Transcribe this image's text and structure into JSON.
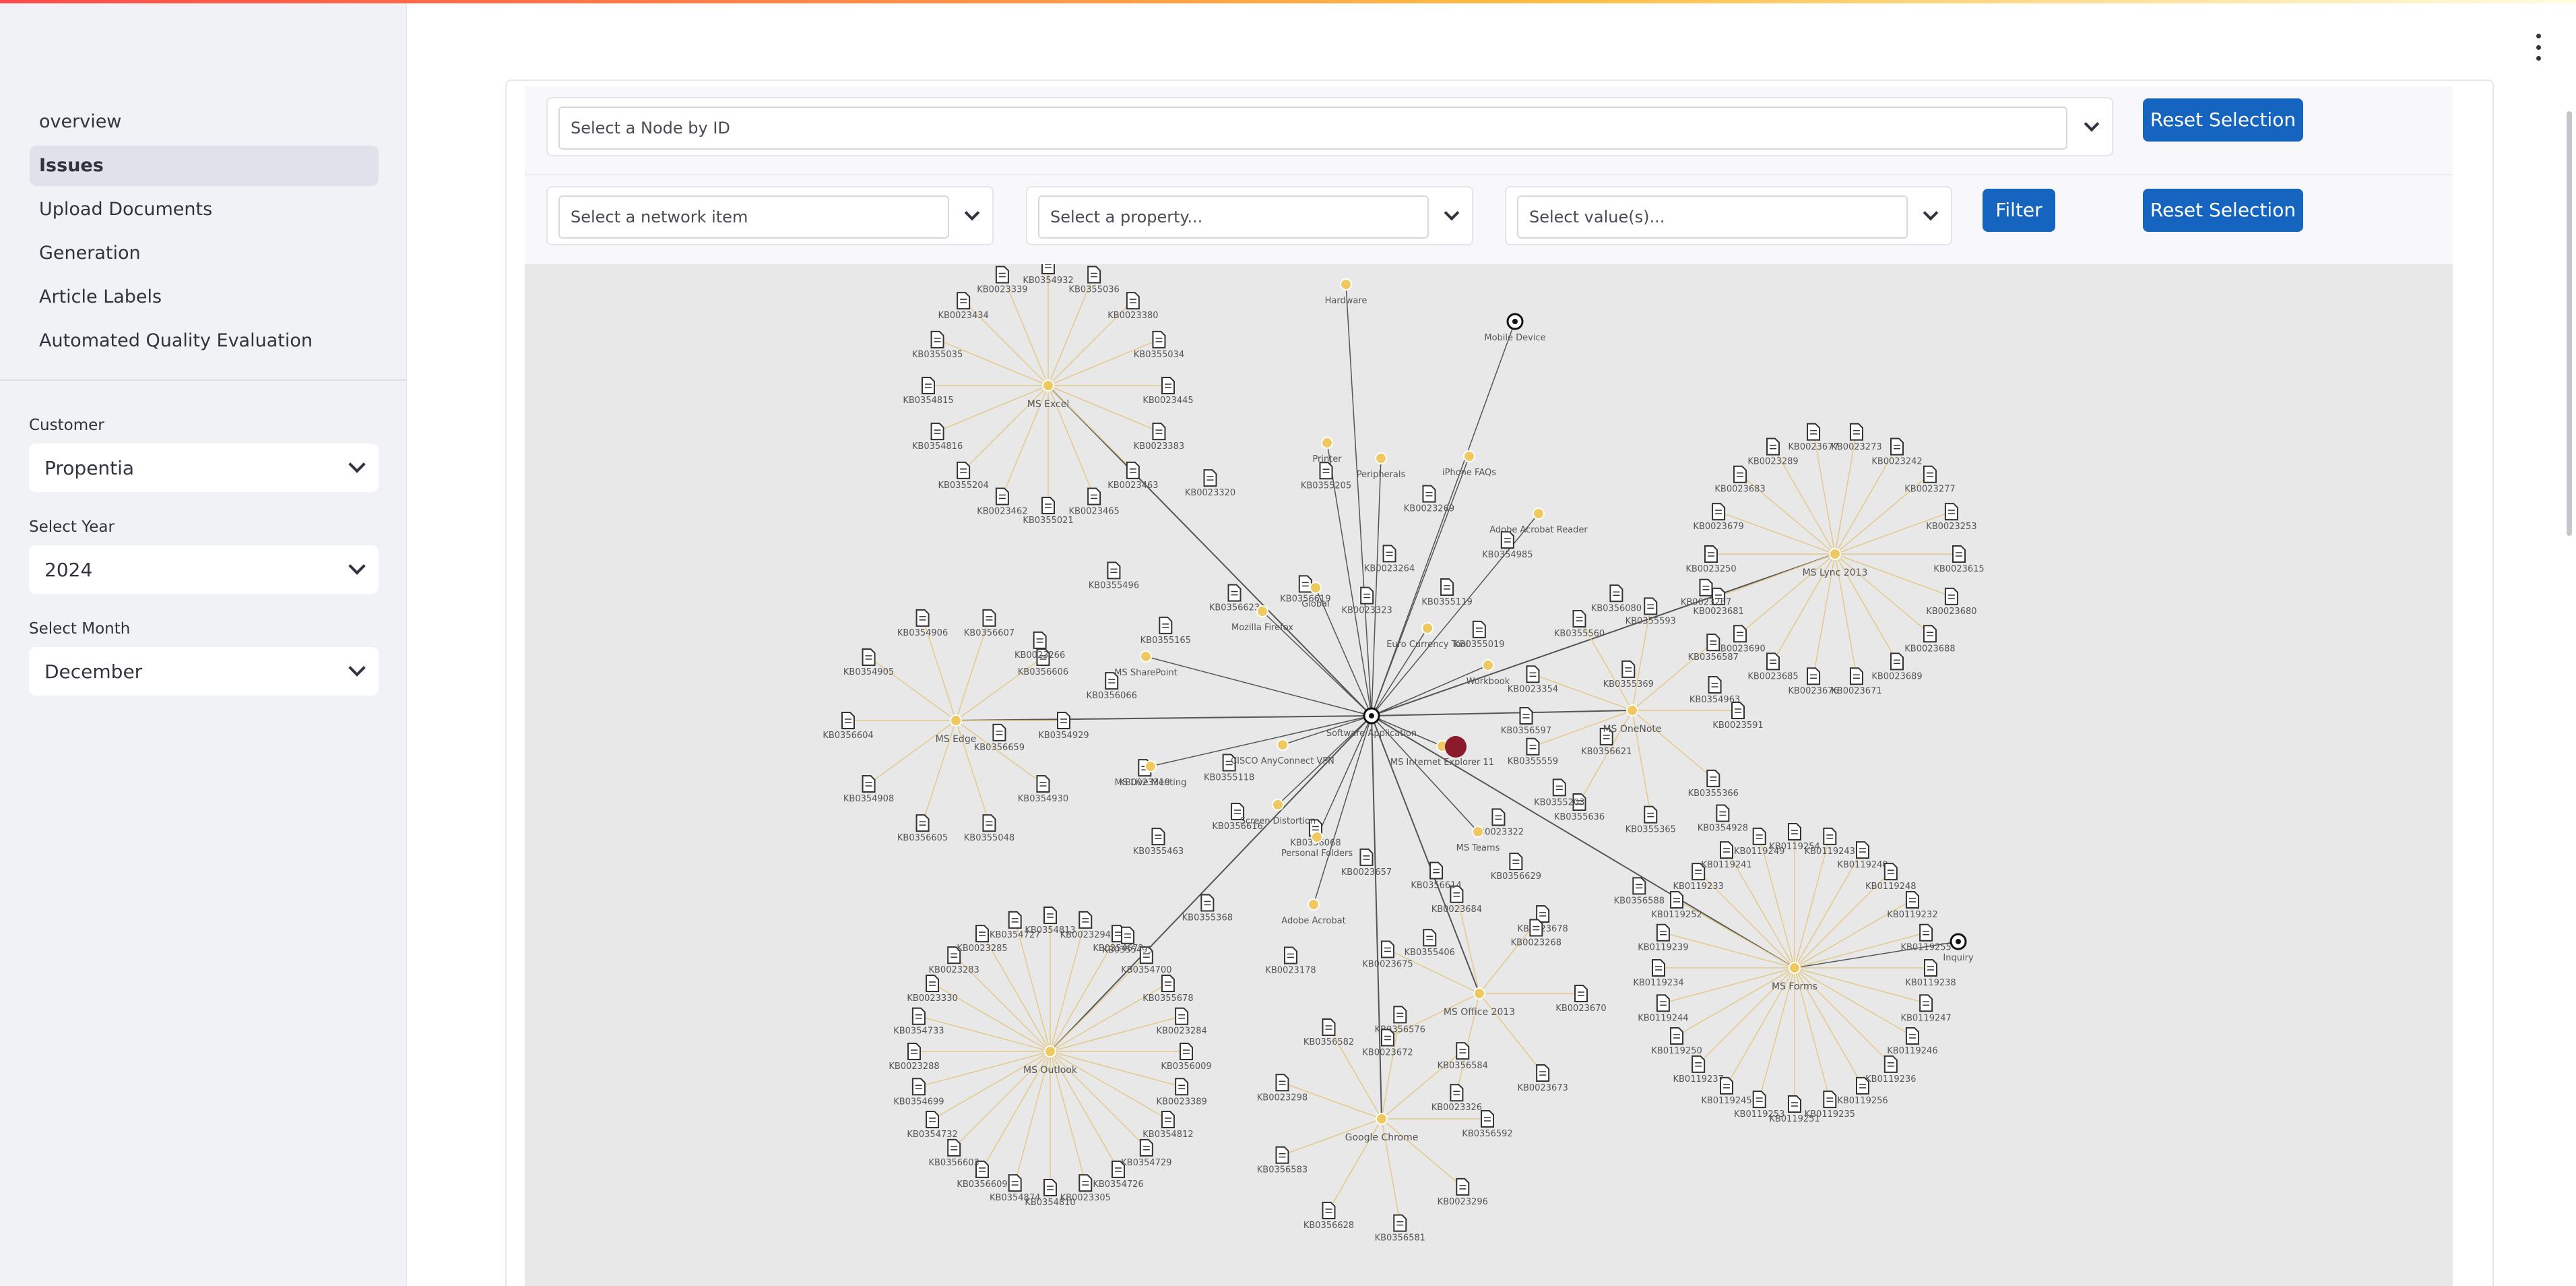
{
  "sidebar": {
    "nav": [
      {
        "label": "overview",
        "active": false
      },
      {
        "label": "Issues",
        "active": true
      },
      {
        "label": "Upload Documents",
        "active": false
      },
      {
        "label": "Generation",
        "active": false
      },
      {
        "label": "Article Labels",
        "active": false
      },
      {
        "label": "Automated Quality Evaluation",
        "active": false
      }
    ],
    "customer": {
      "label": "Customer",
      "value": "Propentia"
    },
    "year": {
      "label": "Select Year",
      "value": "2024"
    },
    "month": {
      "label": "Select Month",
      "value": "December"
    }
  },
  "controls": {
    "node_select_placeholder": "Select a Node by ID",
    "reset_label_1": "Reset Selection",
    "network_item_placeholder": "Select a network item",
    "property_placeholder": "Select a property...",
    "values_placeholder": "Select value(s)...",
    "filter_label": "Filter",
    "reset_label_2": "Reset Selection"
  },
  "colors": {
    "primary_button": "#1565c0",
    "hub_node": "#f0c860",
    "selected_node": "#8b1a2b",
    "edge_spoke": "#e3c98a",
    "edge_main": "#555555"
  },
  "graph": {
    "center": {
      "label": "Software/Application"
    },
    "hubs": [
      {
        "label": "MS Excel",
        "leaves": [
          "KB0023445",
          "KB0023383",
          "KB0023463",
          "KB0023465",
          "KB0355021",
          "KB0023462",
          "KB0355204",
          "KB0354816",
          "KB0354815",
          "KB0355035",
          "KB0023434",
          "KB0023339",
          "KB0354932",
          "KB0355036",
          "KB0023380",
          "KB0355034"
        ]
      },
      {
        "label": "MS Lync 2013",
        "leaves": [
          "KB0023615",
          "KB0023680",
          "KB0023688",
          "KB0023689",
          "KB0023671",
          "KB0023676",
          "KB0023685",
          "KB0023690",
          "KB0023681",
          "KB0023250",
          "KB0023679",
          "KB0023683",
          "KB0023289",
          "KB0023677",
          "KB0023273",
          "KB0023242",
          "KB0023277",
          "KB0023253"
        ]
      },
      {
        "label": "MS Edge",
        "leaves": [
          "KB0354929",
          "KB0354930",
          "KB0355048",
          "KB0356605",
          "KB0354908",
          "KB0356604",
          "KB0354905",
          "KB0354906",
          "KB0356607",
          "KB0356606"
        ]
      },
      {
        "label": "MS Outlook",
        "leaves": [
          "KB0356009",
          "KB0023389",
          "KB0354812",
          "KB0354729",
          "KB0354726",
          "KB0023305",
          "KB0354810",
          "KB0354874",
          "KB0356609",
          "KB0356603",
          "KB0354732",
          "KB0354699",
          "KB0023288",
          "KB0354733",
          "KB0023330",
          "KB0023283",
          "KB0023285",
          "KB0354727",
          "KB0354813",
          "KB0023294",
          "KB0354672",
          "KB0354700",
          "KB0355678",
          "KB0023284"
        ]
      },
      {
        "label": "MS Forms",
        "leaves": [
          "KB0119238",
          "KB0119247",
          "KB0119246",
          "KB0119236",
          "KB0119256",
          "KB0119235",
          "KB0119251",
          "KB0119253",
          "KB0119245",
          "KB0119237",
          "KB0119250",
          "KB0119244",
          "KB0119234",
          "KB0119239",
          "KB0119252",
          "KB0119233",
          "KB0119241",
          "KB0119249",
          "KB0119254",
          "KB0119243",
          "KB0119240",
          "KB0119248",
          "KB0119232",
          "KB0119255"
        ]
      },
      {
        "label": "MS OneNote",
        "leaves": [
          "KB0023591",
          "KB0355366",
          "KB0355365",
          "KB0355636",
          "KB0355559",
          "KB0023354",
          "KB0355560",
          "KB0355593",
          "KB0356587"
        ]
      },
      {
        "label": "Google Chrome",
        "leaves": [
          "KB0356592",
          "KB0023296",
          "KB0356581",
          "KB0356628",
          "KB0356583",
          "KB0023298",
          "KB0356582",
          "KB0356576",
          "KB0356584"
        ]
      },
      {
        "label": "MS Office 2013",
        "leaves": [
          "KB0023670",
          "KB0023673",
          "KB0023326",
          "KB0023672",
          "KB0023675",
          "KB0023684",
          "KB0023678"
        ]
      }
    ],
    "mid_nodes": [
      {
        "label": "Hardware"
      },
      {
        "label": "Mobile Device"
      },
      {
        "label": "Printer"
      },
      {
        "label": "Peripherals"
      },
      {
        "label": "iPhone FAQs"
      },
      {
        "label": "Adobe Acrobat Reader"
      },
      {
        "label": "Global"
      },
      {
        "label": "Mozilla Firefox"
      },
      {
        "label": "MS SharePoint"
      },
      {
        "label": "Euro Currency Tool"
      },
      {
        "label": "Workbook"
      },
      {
        "label": "MS Live Meeting"
      },
      {
        "label": "CISCO AnyConnect VPN"
      },
      {
        "label": "Screen Distortion"
      },
      {
        "label": "Personal Folders"
      },
      {
        "label": "Adobe Acrobat"
      },
      {
        "label": "MS Teams"
      },
      {
        "label": "MS Internet Explorer 11"
      },
      {
        "label": "Inquiry"
      }
    ],
    "misc_docs": [
      "KB0356597",
      "KB0356616",
      "KB0023264",
      "KB0356629",
      "KB0356066",
      "KB0356080",
      "KB0023178",
      "KB0023320",
      "KB0354928",
      "KB0355118",
      "KB0355119",
      "KB0356614",
      "KB0355165",
      "KB0355369",
      "KB0355368",
      "KB0355205",
      "KB0356588",
      "KB0356659",
      "KB0355019",
      "KB0023657",
      "KB0356623",
      "KB0356621",
      "KB0355463",
      "KB0023269",
      "KB0023268",
      "KB0023266",
      "KB0023267",
      "KB0356068",
      "KB0356619",
      "KB0355203",
      "KB0023319",
      "KB0354985",
      "KB0355406",
      "KB0355496",
      "KB0354963",
      "KB0355495",
      "KB0023323",
      "KB0023322"
    ]
  }
}
